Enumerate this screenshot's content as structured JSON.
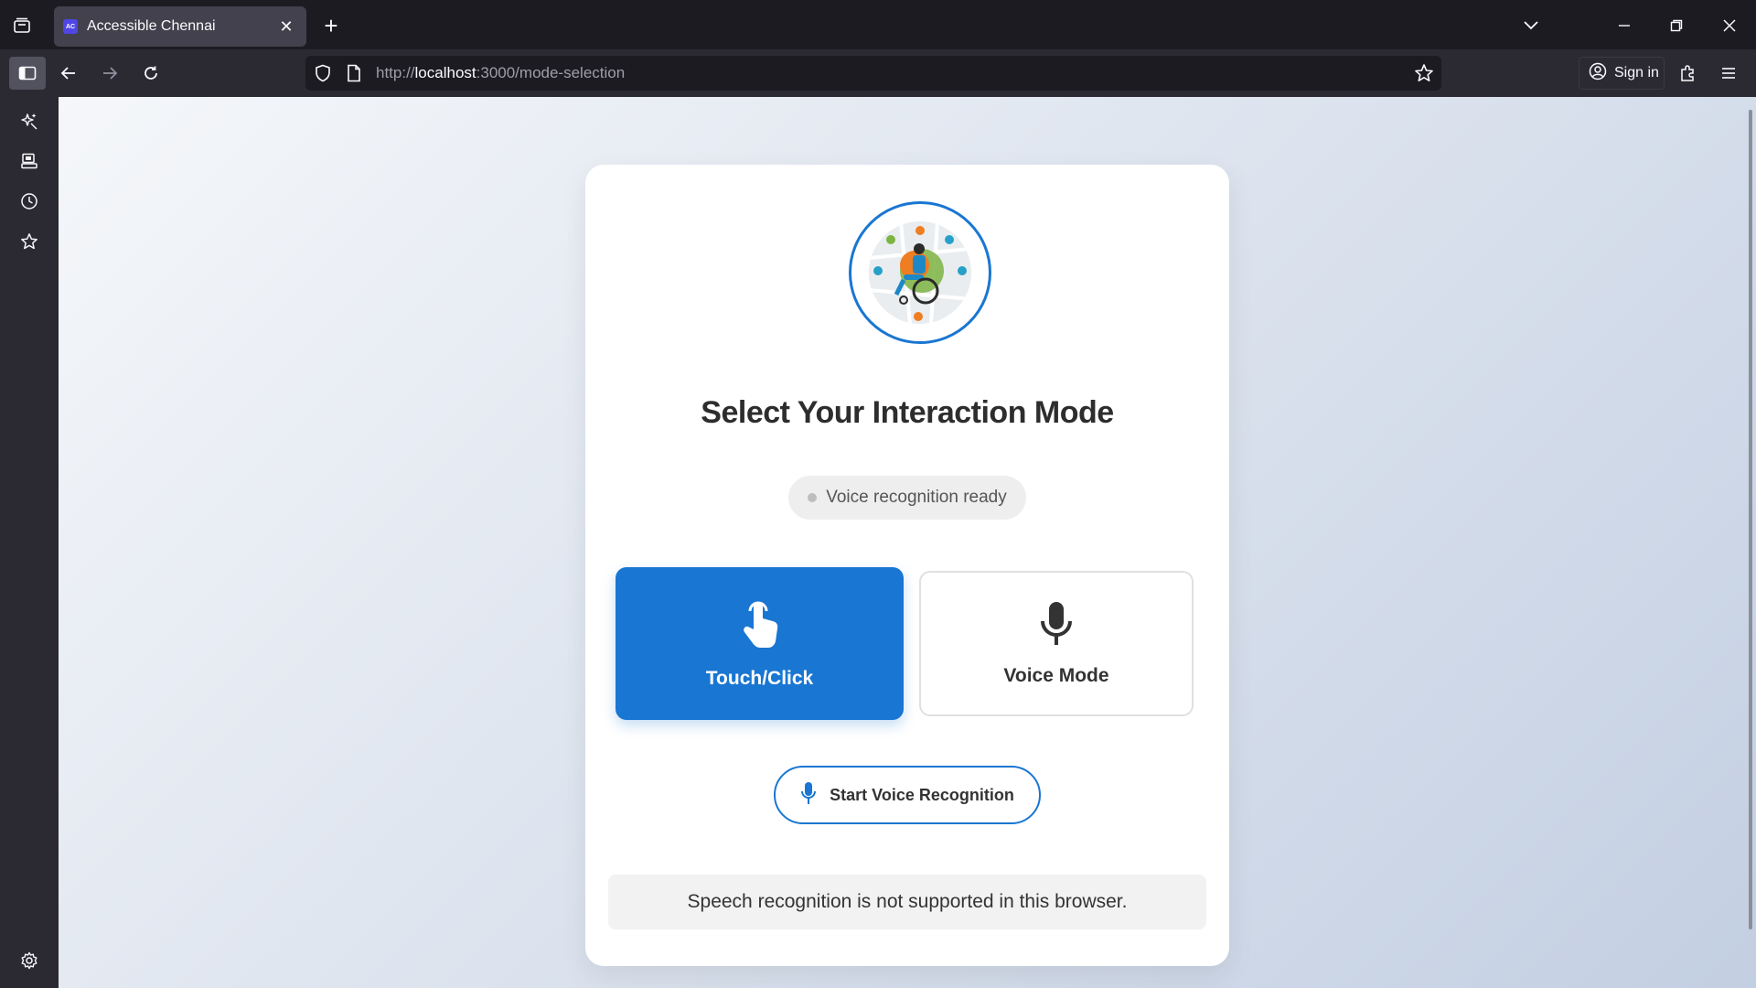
{
  "browser": {
    "tab_title": "Accessible Chennai",
    "tab_favicon_text": "AC",
    "url_prefix": "http://",
    "url_host": "localhost",
    "url_rest": ":3000/mode-selection",
    "signin_label": "Sign in"
  },
  "page": {
    "title": "Select Your Interaction Mode",
    "status_text": "Voice recognition ready",
    "modes": [
      {
        "label": "Touch/Click",
        "icon": "pointer-hand-icon",
        "selected": true
      },
      {
        "label": "Voice Mode",
        "icon": "microphone-icon",
        "selected": false
      }
    ],
    "start_button_label": "Start Voice Recognition",
    "message": "Speech recognition is not supported in this browser."
  },
  "colors": {
    "accent": "#1976d2",
    "background_from": "#f5f7fa",
    "background_to": "#c3cfe2"
  }
}
